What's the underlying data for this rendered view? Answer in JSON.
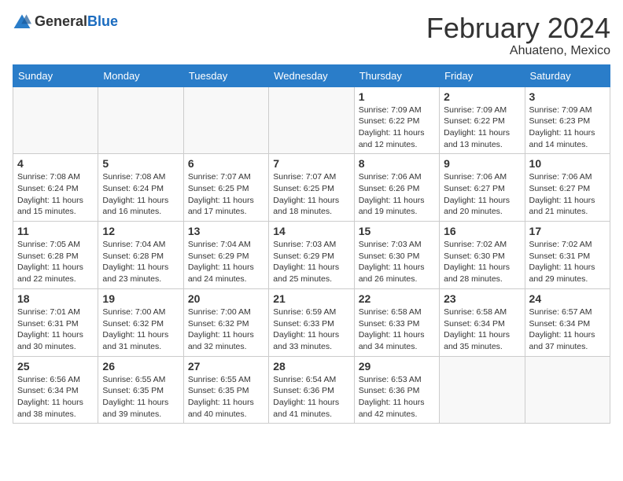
{
  "header": {
    "logo_general": "General",
    "logo_blue": "Blue",
    "month_year": "February 2024",
    "location": "Ahuateno, Mexico"
  },
  "weekdays": [
    "Sunday",
    "Monday",
    "Tuesday",
    "Wednesday",
    "Thursday",
    "Friday",
    "Saturday"
  ],
  "weeks": [
    [
      {
        "day": "",
        "info": ""
      },
      {
        "day": "",
        "info": ""
      },
      {
        "day": "",
        "info": ""
      },
      {
        "day": "",
        "info": ""
      },
      {
        "day": "1",
        "info": "Sunrise: 7:09 AM\nSunset: 6:22 PM\nDaylight: 11 hours and 12 minutes."
      },
      {
        "day": "2",
        "info": "Sunrise: 7:09 AM\nSunset: 6:22 PM\nDaylight: 11 hours and 13 minutes."
      },
      {
        "day": "3",
        "info": "Sunrise: 7:09 AM\nSunset: 6:23 PM\nDaylight: 11 hours and 14 minutes."
      }
    ],
    [
      {
        "day": "4",
        "info": "Sunrise: 7:08 AM\nSunset: 6:24 PM\nDaylight: 11 hours and 15 minutes."
      },
      {
        "day": "5",
        "info": "Sunrise: 7:08 AM\nSunset: 6:24 PM\nDaylight: 11 hours and 16 minutes."
      },
      {
        "day": "6",
        "info": "Sunrise: 7:07 AM\nSunset: 6:25 PM\nDaylight: 11 hours and 17 minutes."
      },
      {
        "day": "7",
        "info": "Sunrise: 7:07 AM\nSunset: 6:25 PM\nDaylight: 11 hours and 18 minutes."
      },
      {
        "day": "8",
        "info": "Sunrise: 7:06 AM\nSunset: 6:26 PM\nDaylight: 11 hours and 19 minutes."
      },
      {
        "day": "9",
        "info": "Sunrise: 7:06 AM\nSunset: 6:27 PM\nDaylight: 11 hours and 20 minutes."
      },
      {
        "day": "10",
        "info": "Sunrise: 7:06 AM\nSunset: 6:27 PM\nDaylight: 11 hours and 21 minutes."
      }
    ],
    [
      {
        "day": "11",
        "info": "Sunrise: 7:05 AM\nSunset: 6:28 PM\nDaylight: 11 hours and 22 minutes."
      },
      {
        "day": "12",
        "info": "Sunrise: 7:04 AM\nSunset: 6:28 PM\nDaylight: 11 hours and 23 minutes."
      },
      {
        "day": "13",
        "info": "Sunrise: 7:04 AM\nSunset: 6:29 PM\nDaylight: 11 hours and 24 minutes."
      },
      {
        "day": "14",
        "info": "Sunrise: 7:03 AM\nSunset: 6:29 PM\nDaylight: 11 hours and 25 minutes."
      },
      {
        "day": "15",
        "info": "Sunrise: 7:03 AM\nSunset: 6:30 PM\nDaylight: 11 hours and 26 minutes."
      },
      {
        "day": "16",
        "info": "Sunrise: 7:02 AM\nSunset: 6:30 PM\nDaylight: 11 hours and 28 minutes."
      },
      {
        "day": "17",
        "info": "Sunrise: 7:02 AM\nSunset: 6:31 PM\nDaylight: 11 hours and 29 minutes."
      }
    ],
    [
      {
        "day": "18",
        "info": "Sunrise: 7:01 AM\nSunset: 6:31 PM\nDaylight: 11 hours and 30 minutes."
      },
      {
        "day": "19",
        "info": "Sunrise: 7:00 AM\nSunset: 6:32 PM\nDaylight: 11 hours and 31 minutes."
      },
      {
        "day": "20",
        "info": "Sunrise: 7:00 AM\nSunset: 6:32 PM\nDaylight: 11 hours and 32 minutes."
      },
      {
        "day": "21",
        "info": "Sunrise: 6:59 AM\nSunset: 6:33 PM\nDaylight: 11 hours and 33 minutes."
      },
      {
        "day": "22",
        "info": "Sunrise: 6:58 AM\nSunset: 6:33 PM\nDaylight: 11 hours and 34 minutes."
      },
      {
        "day": "23",
        "info": "Sunrise: 6:58 AM\nSunset: 6:34 PM\nDaylight: 11 hours and 35 minutes."
      },
      {
        "day": "24",
        "info": "Sunrise: 6:57 AM\nSunset: 6:34 PM\nDaylight: 11 hours and 37 minutes."
      }
    ],
    [
      {
        "day": "25",
        "info": "Sunrise: 6:56 AM\nSunset: 6:34 PM\nDaylight: 11 hours and 38 minutes."
      },
      {
        "day": "26",
        "info": "Sunrise: 6:55 AM\nSunset: 6:35 PM\nDaylight: 11 hours and 39 minutes."
      },
      {
        "day": "27",
        "info": "Sunrise: 6:55 AM\nSunset: 6:35 PM\nDaylight: 11 hours and 40 minutes."
      },
      {
        "day": "28",
        "info": "Sunrise: 6:54 AM\nSunset: 6:36 PM\nDaylight: 11 hours and 41 minutes."
      },
      {
        "day": "29",
        "info": "Sunrise: 6:53 AM\nSunset: 6:36 PM\nDaylight: 11 hours and 42 minutes."
      },
      {
        "day": "",
        "info": ""
      },
      {
        "day": "",
        "info": ""
      }
    ]
  ]
}
